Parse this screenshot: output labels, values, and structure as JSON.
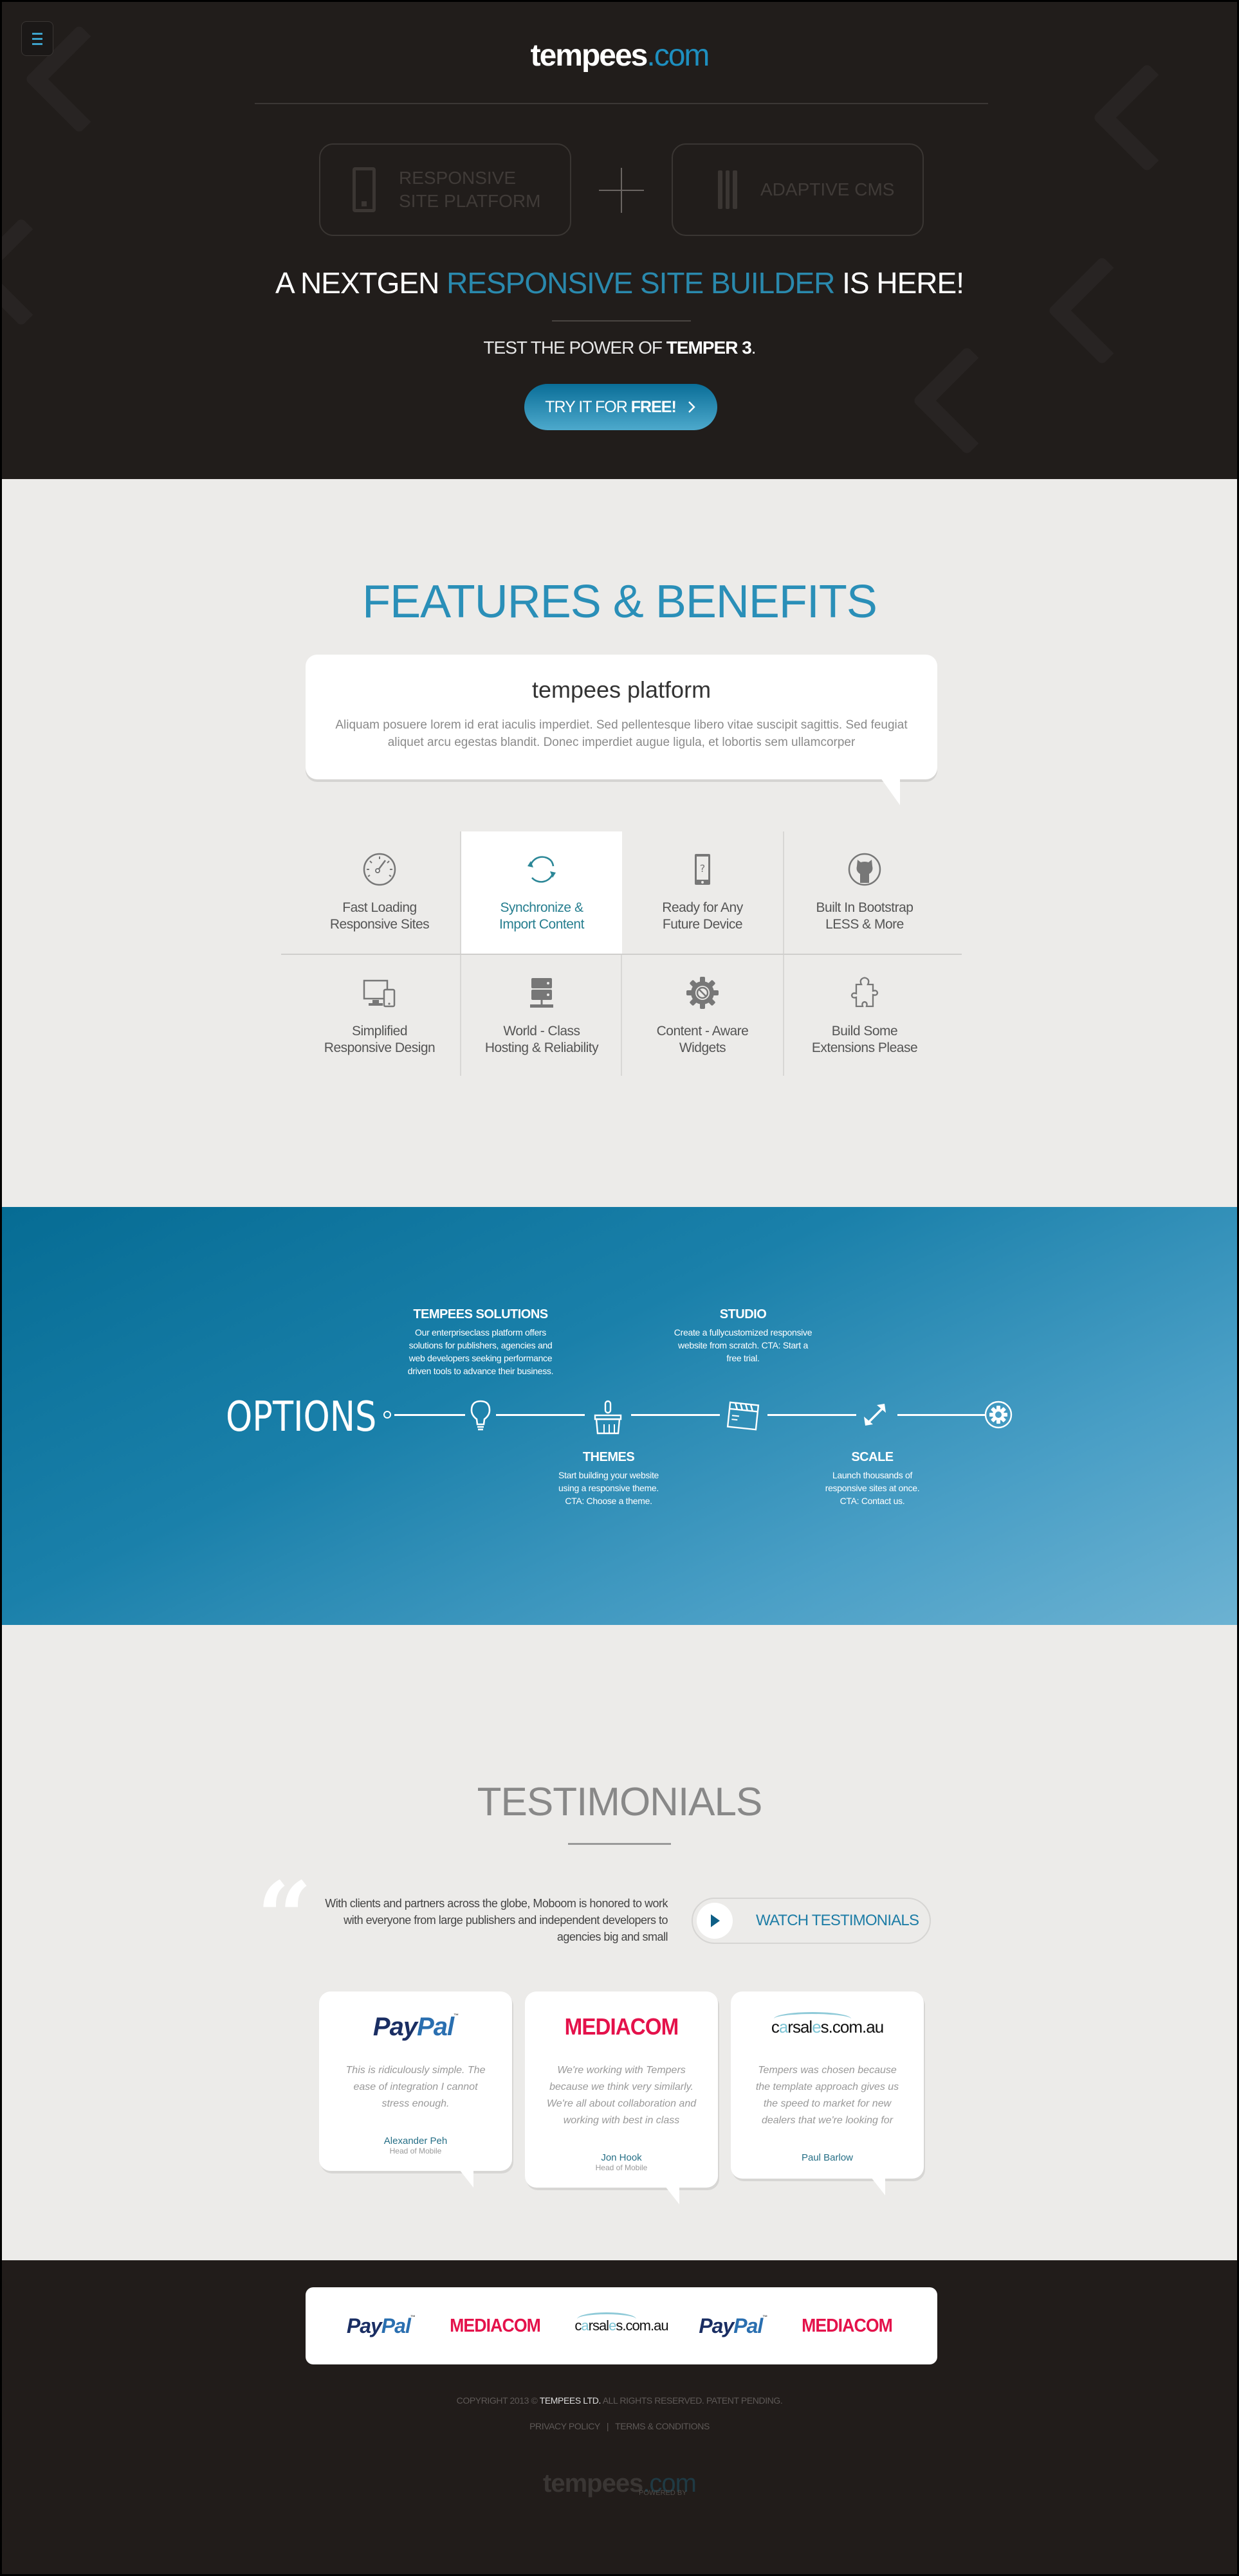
{
  "header": {
    "logo_main": "tempees",
    "logo_tld": ".com",
    "menu_icon": "hamburger-icon"
  },
  "hero": {
    "pill_left": {
      "icon": "mobile-phone-icon",
      "line1": "RESPONSIVE",
      "line2": "SITE PLATFORM"
    },
    "pill_right": {
      "icon": "sliders-icon",
      "label": "ADAPTIVE CMS"
    },
    "plus_icon": "plus-icon",
    "headline_pre": "A NEXTGEN ",
    "headline_accent": "RESPONSIVE SITE BUILDER",
    "headline_post": " IS HERE!",
    "sub_pre": "TEST THE POWER OF ",
    "sub_bold": "TEMPER 3",
    "sub_post": ".",
    "cta_pre": "TRY IT FOR ",
    "cta_bold": "FREE!",
    "cta_icon": "chevron-right-icon"
  },
  "features": {
    "title": "FEATURES & BENEFITS",
    "bubble_title": "tempees platform",
    "bubble_text": "Aliquam posuere lorem id erat iaculis imperdiet. Sed pellentesque libero vitae suscipit sagittis. Sed feugiat aliquet arcu egestas blandit. Donec imperdiet augue ligula, et lobortis sem ullamcorper",
    "items": [
      {
        "line1": "Fast Loading",
        "line2": "Responsive Sites",
        "icon": "speedometer-icon",
        "active": false
      },
      {
        "line1": "Synchronize &",
        "line2": "Import Content",
        "icon": "sync-icon",
        "active": true
      },
      {
        "line1": "Ready for Any",
        "line2": "Future Device",
        "icon": "device-question-icon",
        "active": false
      },
      {
        "line1": "Built In Bootstrap",
        "line2": "LESS & More",
        "icon": "github-octocat-icon",
        "active": false
      },
      {
        "line1": "Simplified",
        "line2": "Responsive Design",
        "icon": "devices-icon",
        "active": false
      },
      {
        "line1": "World - Class",
        "line2": "Hosting & Reliability",
        "icon": "server-icon",
        "active": false
      },
      {
        "line1": "Content - Aware",
        "line2": "Widgets",
        "icon": "gear-blocked-icon",
        "active": false
      },
      {
        "line1": "Build Some",
        "line2": "Extensions Please",
        "icon": "puzzle-piece-icon",
        "active": false
      }
    ]
  },
  "options": {
    "title": "OPTIONS",
    "steps": [
      {
        "title": "TEMPEES SOLUTIONS",
        "text": "Our enterpriseclass platform offers solutions for publishers, agencies and web developers seeking performance driven tools to advance their business.",
        "icon": "lightbulb-icon"
      },
      {
        "title": "THEMES",
        "text": "Start building your website using a responsive theme. CTA: Choose a theme.",
        "icon": "paintbrush-icon"
      },
      {
        "title": "STUDIO",
        "text": "Create a fullycustomized responsive website from scratch. CTA: Start a free trial.",
        "icon": "clapperboard-icon"
      },
      {
        "title": "SCALE",
        "text": "Launch thousands of responsive sites at once. CTA: Contact us.",
        "icon": "expand-arrows-icon"
      }
    ],
    "end_icon": "gear-circle-icon"
  },
  "testimonials": {
    "title": "TESTIMONIALS",
    "intro": "With clients and partners across the globe, Moboom is honored to work with everyone from large publishers and independent developers to agencies big and small",
    "watch_label": "WATCH TESTIMONIALS",
    "cards": [
      {
        "brand": "PayPal",
        "quote": "This is ridiculously simple. The ease of integration I cannot stress enough.",
        "name": "Alexander Peh",
        "role": "Head of Mobile"
      },
      {
        "brand": "MEDIACOM",
        "quote": "We're working with Tempers because we think very similarly. We're all about collaboration and working with best in class",
        "name": "Jon Hook",
        "role": "Head of Mobile"
      },
      {
        "brand": "carsales.com.au",
        "quote": "Tempers was chosen because the template approach gives us the speed to market for new dealers that we're looking for",
        "name": "Paul Barlow",
        "role": ""
      }
    ]
  },
  "brands": {
    "paypal_a": "Pay",
    "paypal_b": "Pal",
    "paypal_tm": "™",
    "mediacom": "MEDIACOM",
    "carsales_a": "c",
    "carsales_b": "a",
    "carsales_c": "rsal",
    "carsales_d": "e",
    "carsales_e": "s.com.au"
  },
  "footer": {
    "copyright_pre": "COPYRIGHT 2013 © ",
    "copyright_company": "TEMPEES LTD.",
    "copyright_post": " ALL RIGHTS RESERVED. PATENT PENDING.",
    "privacy": "PRIVACY POLICY",
    "separator": "|",
    "terms": "TERMS & CONDITIONS",
    "logo_main": "tempees",
    "logo_tld": ".com",
    "powered_by": "POWERED BY"
  },
  "colors": {
    "accent": "#1e8fbf",
    "hero_bg": "#211d1b",
    "light_bg": "#ecebe9",
    "options_blue": "#066c94",
    "mediacom_red": "#e4124b",
    "paypal_navy": "#1a2e63"
  }
}
